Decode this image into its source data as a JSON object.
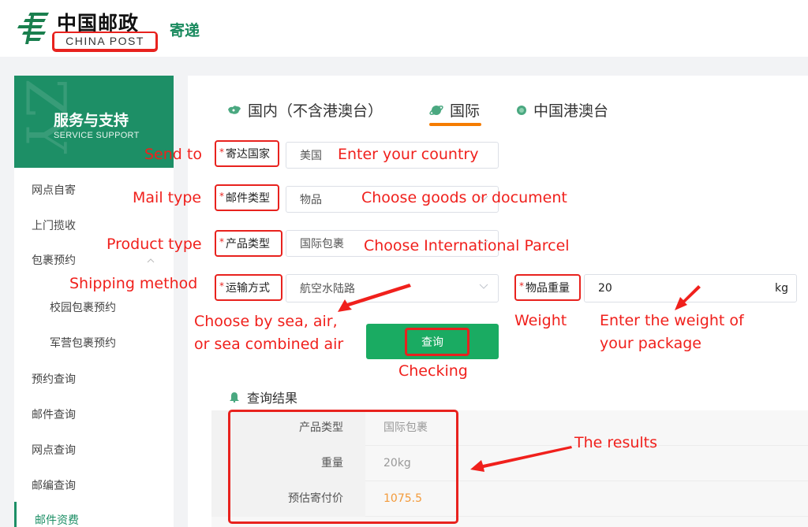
{
  "header": {
    "logo_cn": "中国邮政",
    "logo_en": "CHINA POST",
    "logo_sub": "寄递",
    "brand_color": "#1d8f66"
  },
  "sidebar": {
    "banner_cn": "服务与支持",
    "banner_en": "SERVICE SUPPORT",
    "items": [
      {
        "label": "网点自寄"
      },
      {
        "label": "上门揽收"
      },
      {
        "label": "包裹预约",
        "expanded": true
      },
      {
        "label": "校园包裹预约",
        "sub": true
      },
      {
        "label": "军营包裹预约",
        "sub": true
      },
      {
        "label": "预约查询"
      },
      {
        "label": "邮件查询"
      },
      {
        "label": "网点查询"
      },
      {
        "label": "邮编查询"
      },
      {
        "label": "邮件资费",
        "active": true
      }
    ]
  },
  "tabs": [
    {
      "label": "国内（不含港澳台）",
      "icon": "china-map-icon"
    },
    {
      "label": "国际",
      "icon": "planet-icon",
      "active": true
    },
    {
      "label": "中国港澳台",
      "icon": "hk-badge-icon"
    }
  ],
  "form": {
    "required_mark": "*",
    "destination": {
      "label": "寄达国家",
      "value": "美国"
    },
    "mail_type": {
      "label": "邮件类型",
      "value": "物品"
    },
    "product_type": {
      "label": "产品类型",
      "value": "国际包裹"
    },
    "shipping_method": {
      "label": "运输方式",
      "value": "航空水陆路"
    },
    "weight": {
      "label": "物品重量",
      "value": "20",
      "unit": "kg"
    },
    "query_button": "查询"
  },
  "results": {
    "title": "查询结果",
    "rows": [
      {
        "key": "产品类型",
        "value": "国际包裹"
      },
      {
        "key": "重量",
        "value": "20kg"
      },
      {
        "key": "预估寄付价",
        "value": "1075.5"
      }
    ],
    "price_color": "#f39a3a"
  },
  "annotations": {
    "send_to": "Send to",
    "enter_country": "Enter your country",
    "mail_type": "Mail type",
    "choose_goods": "Choose goods or document",
    "product_type": "Product type",
    "choose_parcel": "Choose International Parcel",
    "shipping_method": "Shipping method",
    "choose_by_line1": "Choose by sea, air,",
    "choose_by_line2": "or sea combined air",
    "weight": "Weight",
    "enter_weight_line1": "Enter the weight of",
    "enter_weight_line2": "your package",
    "checking": "Checking",
    "the_results": "The results",
    "color": "#f0201c"
  }
}
